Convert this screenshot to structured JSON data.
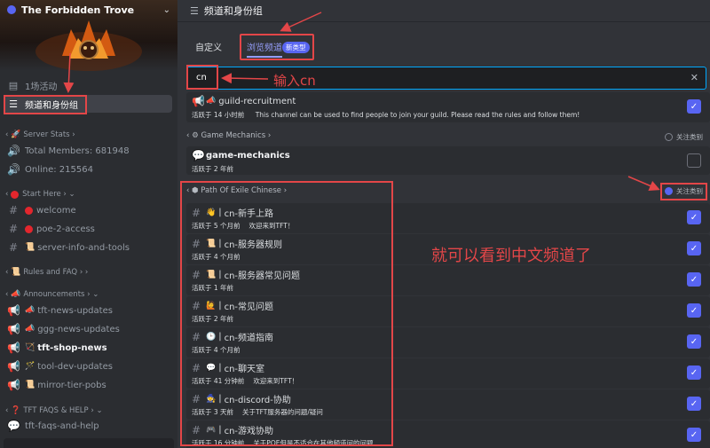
{
  "server": {
    "name": "The Forbidden Trove"
  },
  "nav": [
    {
      "label": "1场活动",
      "icon": "calendar-icon"
    },
    {
      "label": "频道和身份组",
      "icon": "channels-roles-icon"
    }
  ],
  "sidebar": {
    "server_stats": {
      "label": "Server Stats",
      "items": [
        "Total Members: 681948",
        "Online: 215564"
      ]
    },
    "start_here": {
      "label": "Start Here",
      "items": [
        "welcome",
        "poe-2-access",
        "server-info-and-tools"
      ]
    },
    "rules": {
      "label": "Rules and FAQ"
    },
    "announcements": {
      "label": "Announcements",
      "items": [
        "tft-news-updates",
        "ggg-news-updates",
        "tft-shop-news",
        "tool-dev-updates",
        "mirror-tier-pobs"
      ]
    },
    "faqs": {
      "label": "TFT FAQS & HELP",
      "items": [
        "tft-faqs-and-help"
      ]
    }
  },
  "main": {
    "title": "频道和身份组",
    "tab_custom": "自定义",
    "tab_browse": "浏览频道",
    "new_badge": "新类型",
    "search_value": "cn",
    "search_clear": "✕"
  },
  "rows": [
    {
      "name": "guild-recruitment",
      "active": "活跃于 14 小时前",
      "desc": "This channel can be used to find people to join your guild. Please read the rules and follow them!",
      "checked": true
    },
    {
      "name": "game-mechanics",
      "active": "活跃于 2 年前",
      "desc": "",
      "checked": false
    }
  ],
  "categories": {
    "game_mechanics": "Game Mechanics",
    "poe_chinese": "Path Of Exile Chinese",
    "follow_label": "关注类别"
  },
  "cn_rows": [
    {
      "name": "cn-新手上路",
      "active": "活跃于 5 个月前",
      "desc": "欢迎来到TFT！",
      "emoji": "👋"
    },
    {
      "name": "cn-服务器规则",
      "active": "活跃于 4 个月前",
      "desc": "",
      "emoji": "📜"
    },
    {
      "name": "cn-服务器常见问题",
      "active": "活跃于 1 年前",
      "desc": "",
      "emoji": "📜"
    },
    {
      "name": "cn-常见问题",
      "active": "活跃于 2 年前",
      "desc": "",
      "emoji": "🙋"
    },
    {
      "name": "cn-频道指南",
      "active": "活跃于 4 个月前",
      "desc": "",
      "emoji": "🕒"
    },
    {
      "name": "cn-聊天室",
      "active": "活跃于 41 分钟前",
      "desc": "欢迎来到TFT！",
      "emoji": "💬"
    },
    {
      "name": "cn-discord-协助",
      "active": "活跃于 3 天前",
      "desc": "关于TFT服务器的问题/疑问",
      "emoji": "🧙"
    },
    {
      "name": "cn-游戏协助",
      "active": "活跃于 16 分钟前",
      "desc": "关于POE但是不适合在其他频道问的问题",
      "emoji": "🎮"
    }
  ],
  "annotations": {
    "input_cn": "输入cn",
    "see_chinese": "就可以看到中文频道了"
  },
  "colors": {
    "accent": "#5865f2",
    "annotation": "#e34648",
    "search_border": "#00a8fc"
  }
}
